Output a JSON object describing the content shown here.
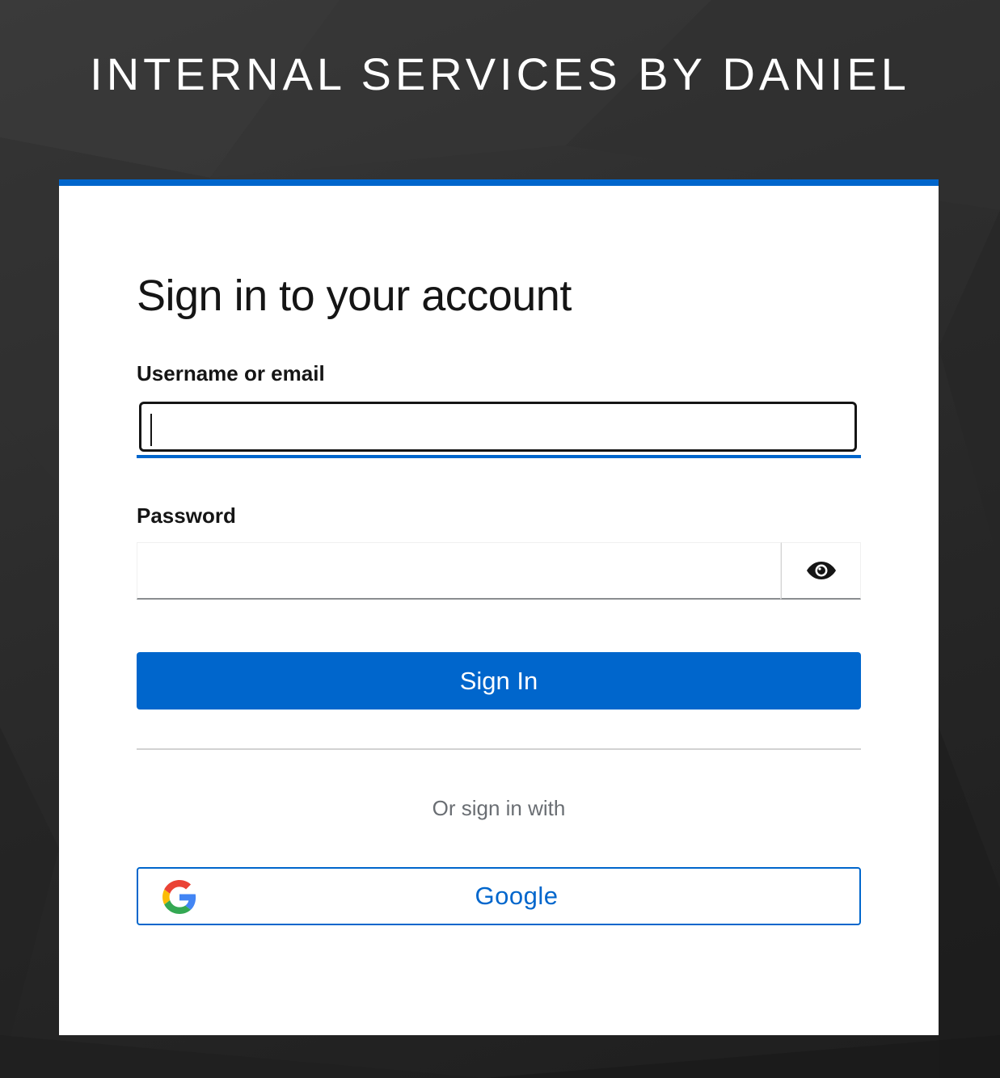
{
  "realm": {
    "title": "INTERNAL SERVICES BY DANIEL"
  },
  "login": {
    "heading": "Sign in to your account",
    "username_label": "Username or email",
    "username_value": "",
    "password_label": "Password",
    "password_value": "",
    "show_password_icon": "eye-icon",
    "submit_label": "Sign In",
    "divider_text": "Or sign in with"
  },
  "providers": [
    {
      "label": "Google",
      "icon": "google-icon"
    }
  ],
  "colors": {
    "accent": "#0066cc",
    "background": "#2b2b2b",
    "card": "#ffffff",
    "text": "#151515",
    "muted": "#6a6e73"
  }
}
